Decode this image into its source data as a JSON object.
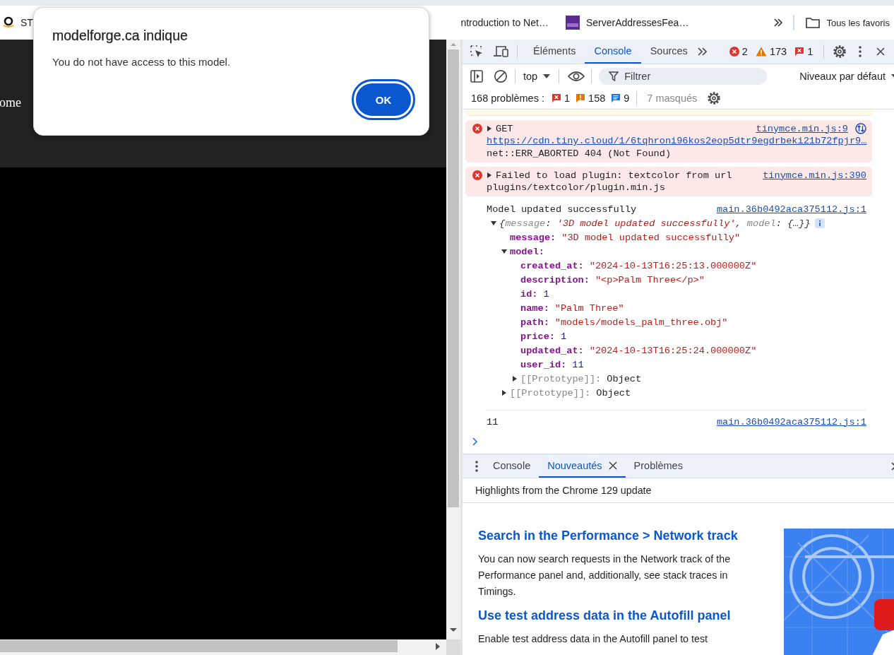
{
  "browser": {
    "bookmarks": [
      {
        "label": "ST"
      },
      {
        "label": "ntroduction to Net…"
      },
      {
        "label": "ServerAddressesFea…"
      }
    ],
    "folder": "Tous les favoris"
  },
  "page": {
    "header_text": "ome"
  },
  "dialog": {
    "title": "modelforge.ca indique",
    "message": "You do not have access to this model.",
    "button": "OK"
  },
  "devtools": {
    "tabs": [
      {
        "label": "Éléments",
        "selected": false
      },
      {
        "label": "Console",
        "selected": true
      },
      {
        "label": "Sources",
        "selected": false
      }
    ],
    "counts": [
      {
        "kind": "error",
        "count": "2"
      },
      {
        "kind": "warning",
        "count": "173"
      },
      {
        "kind": "issue",
        "count": "1"
      }
    ],
    "context": "top",
    "filter_placeholder": "Filtrer",
    "levels": "Niveaux par défaut",
    "issues": {
      "label": "168 problèmes :",
      "counts": [
        {
          "kind": "issue",
          "count": "1"
        },
        {
          "kind": "warning",
          "count": "158"
        },
        {
          "kind": "info",
          "count": "9"
        }
      ],
      "hidden": "7 masqués"
    }
  },
  "console": {
    "messages": [
      {
        "kind": "warning"
      },
      {
        "kind": "error",
        "expanded": false,
        "text": "GET",
        "source": "tinymce.min.js:9",
        "url": "https://cdn.tiny.cloud/1/6tqhroni96kos2eop5dtr9egdrbeki21b72fpjr9…",
        "detail": "net::ERR_ABORTED 404 (Not Found)"
      },
      {
        "kind": "error",
        "expanded": false,
        "text": "Failed to load plugin: textcolor from url",
        "source": "tinymce.min.js:390",
        "detail": "plugins/textcolor/plugin.min.js"
      },
      {
        "kind": "log",
        "text": "Model updated successfully",
        "source": "main.36b0492aca375112.js:1"
      },
      {
        "kind": "object",
        "expanded": true,
        "summary": [
          {
            "text": "{",
            "kind": "punct"
          },
          {
            "text": "message",
            "kind": "key"
          },
          {
            "text": ": ",
            "kind": "punct"
          },
          {
            "text": "'3D model updated successfully'",
            "kind": "string"
          },
          {
            "text": ", ",
            "kind": "punct"
          },
          {
            "text": "model",
            "kind": "key"
          },
          {
            "text": ": {…}}",
            "kind": "punct"
          }
        ],
        "children": [
          {
            "key": "message:",
            "value": "\"3D model updated successfully\"",
            "kind": "string"
          },
          {
            "key": "model:",
            "expanded": true,
            "children": [
              {
                "key": "created_at:",
                "value": "\"2024-10-13T16:25:13.000000Z\"",
                "kind": "string"
              },
              {
                "key": "description:",
                "value": "\"<p>Palm Three</p>\"",
                "kind": "string"
              },
              {
                "key": "id:",
                "value": "1",
                "kind": "number"
              },
              {
                "key": "name:",
                "value": "\"Palm Three\"",
                "kind": "string"
              },
              {
                "key": "path:",
                "value": "\"models/models_palm_three.obj\"",
                "kind": "string"
              },
              {
                "key": "price:",
                "value": "1",
                "kind": "number"
              },
              {
                "key": "updated_at:",
                "value": "\"2024-10-13T16:25:24.000000Z\"",
                "kind": "string"
              },
              {
                "key": "user_id:",
                "value": "11",
                "kind": "number"
              },
              {
                "key": "[[Prototype]]:",
                "value": "Object",
                "kind": "object",
                "internal": true,
                "expanded": false
              }
            ]
          },
          {
            "key": "[[Prototype]]:",
            "value": "Object",
            "kind": "object",
            "internal": true,
            "expanded": false
          }
        ]
      },
      {
        "kind": "log",
        "text": "11",
        "source": "main.36b0492aca375112.js:1",
        "separated": true
      }
    ]
  },
  "drawer": {
    "tabs": [
      {
        "label": "Console",
        "selected": false,
        "closable": false
      },
      {
        "label": "Nouveautés",
        "selected": true,
        "closable": true
      },
      {
        "label": "Problèmes",
        "selected": false,
        "closable": false
      }
    ],
    "subtitle": "Highlights from the Chrome 129 update",
    "articles": [
      {
        "title": "Search in the Performance > Network track",
        "body": "You can now search requests in the Network track of the Performance panel and, additionally, see stack traces in Timings."
      },
      {
        "title": "Use test address data in the Autofill panel",
        "body": "Enable test address data in the Autofill panel to test"
      }
    ]
  }
}
